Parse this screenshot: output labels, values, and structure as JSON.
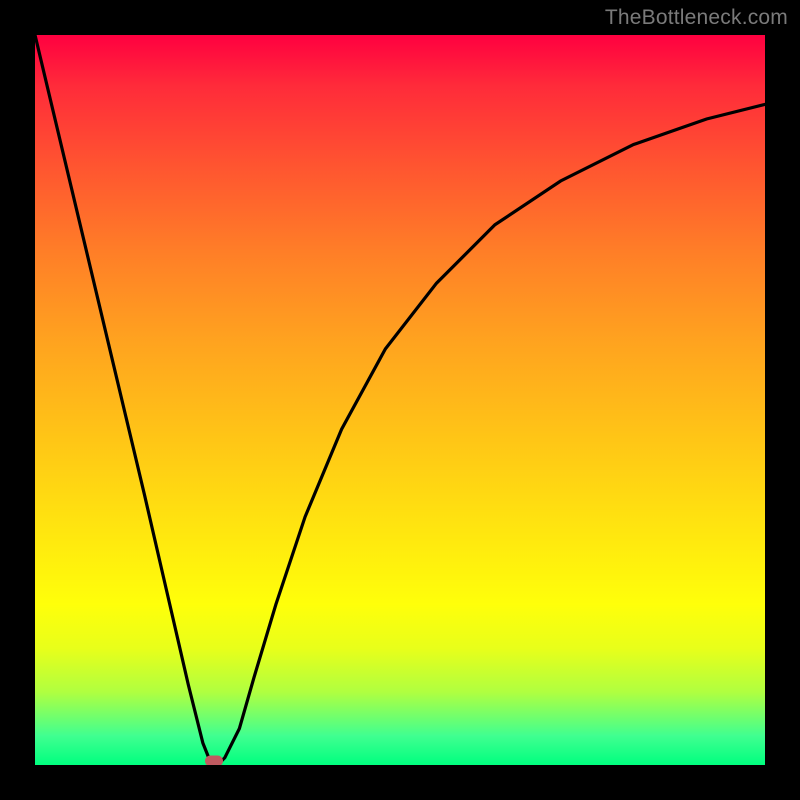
{
  "watermark": "TheBottleneck.com",
  "chart_data": {
    "type": "line",
    "title": "",
    "xlabel": "",
    "ylabel": "",
    "xlim": [
      0,
      100
    ],
    "ylim": [
      0,
      100
    ],
    "grid": false,
    "background_gradient": [
      "#ff0040",
      "#ff7f27",
      "#ffff0a",
      "#00ff7f"
    ],
    "series": [
      {
        "name": "bottleneck-curve",
        "x": [
          0,
          5,
          10,
          15,
          18,
          21,
          23,
          24,
          25,
          26,
          28,
          30,
          33,
          37,
          42,
          48,
          55,
          63,
          72,
          82,
          92,
          100
        ],
        "y": [
          100,
          79,
          58,
          37,
          24,
          11,
          3,
          0.5,
          0,
          1,
          5,
          12,
          22,
          34,
          46,
          57,
          66,
          74,
          80,
          85,
          88.5,
          90.5
        ]
      }
    ],
    "marker": {
      "x": 24.5,
      "y": 0.5,
      "color": "#c05a60"
    }
  }
}
